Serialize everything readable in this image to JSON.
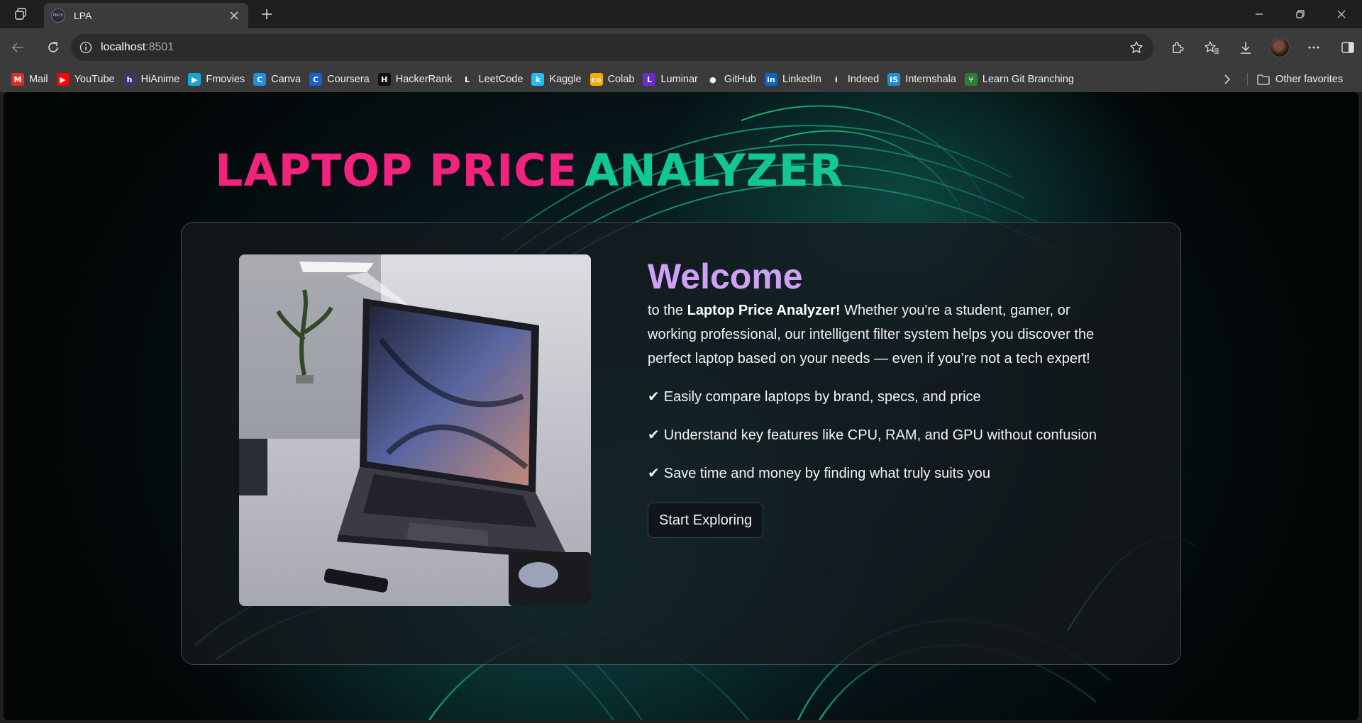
{
  "browser": {
    "tab": {
      "title": "LPA",
      "favicon_text": "PRICE"
    },
    "address": {
      "host": "localhost",
      "port": ":8501"
    },
    "bookmarks": [
      {
        "label": "Mail",
        "icon": "gmail-icon",
        "color": "#d93025",
        "glyph": "M"
      },
      {
        "label": "YouTube",
        "icon": "youtube-icon",
        "color": "#ff0000",
        "glyph": "▶"
      },
      {
        "label": "HiAnime",
        "icon": "hianime-icon",
        "color": "#3b3575",
        "glyph": "h"
      },
      {
        "label": "Fmovies",
        "icon": "fmovies-icon",
        "color": "#1aa3d6",
        "glyph": "▶"
      },
      {
        "label": "Canva",
        "icon": "canva-icon",
        "color": "#1f8fe0",
        "glyph": "C"
      },
      {
        "label": "Coursera",
        "icon": "coursera-icon",
        "color": "#1a5fd0",
        "glyph": "C"
      },
      {
        "label": "HackerRank",
        "icon": "hackerrank-icon",
        "color": "#111111",
        "glyph": "H"
      },
      {
        "label": "LeetCode",
        "icon": "leetcode-icon",
        "color": "#3b3b3b",
        "glyph": "L"
      },
      {
        "label": "Kaggle",
        "icon": "kaggle-icon",
        "color": "#20beff",
        "glyph": "k"
      },
      {
        "label": "Colab",
        "icon": "colab-icon",
        "color": "#f9ab00",
        "glyph": "co"
      },
      {
        "label": "Luminar",
        "icon": "luminar-icon",
        "color": "#6a2bd6",
        "glyph": "L"
      },
      {
        "label": "GitHub",
        "icon": "github-icon",
        "color": "#3b3b3b",
        "glyph": "●"
      },
      {
        "label": "LinkedIn",
        "icon": "linkedin-icon",
        "color": "#0a66c2",
        "glyph": "in"
      },
      {
        "label": "Indeed",
        "icon": "indeed-icon",
        "color": "#3b3b3b",
        "glyph": "i"
      },
      {
        "label": "Internshala",
        "icon": "internshala-icon",
        "color": "#1a8fd6",
        "glyph": "IS"
      },
      {
        "label": "Learn Git Branching",
        "icon": "learn-git-branching-icon",
        "color": "#2e7d32",
        "glyph": "⑂"
      }
    ],
    "other_favorites": "Other favorites"
  },
  "page": {
    "title_part1": "LAPTOP PRICE",
    "title_part2": "ANALYZER",
    "welcome": "Welcome",
    "intro_prefix": "to the ",
    "intro_bold": "Laptop Price Analyzer!",
    "intro_rest": " Whether you're a student, gamer, or working professional, our intelligent filter system helps you discover the perfect laptop based on your needs — even if you’re not a tech expert!",
    "check_mark": "✔",
    "features": [
      "Easily compare laptops by brand, specs, and price",
      "Understand key features like CPU, RAM, and GPU without confusion",
      "Save time and money by finding what truly suits you"
    ],
    "cta_label": "Start Exploring"
  },
  "colors": {
    "title_pink": "#f1237f",
    "title_green": "#12c795",
    "welcome_purple": "#cfa0f5"
  }
}
